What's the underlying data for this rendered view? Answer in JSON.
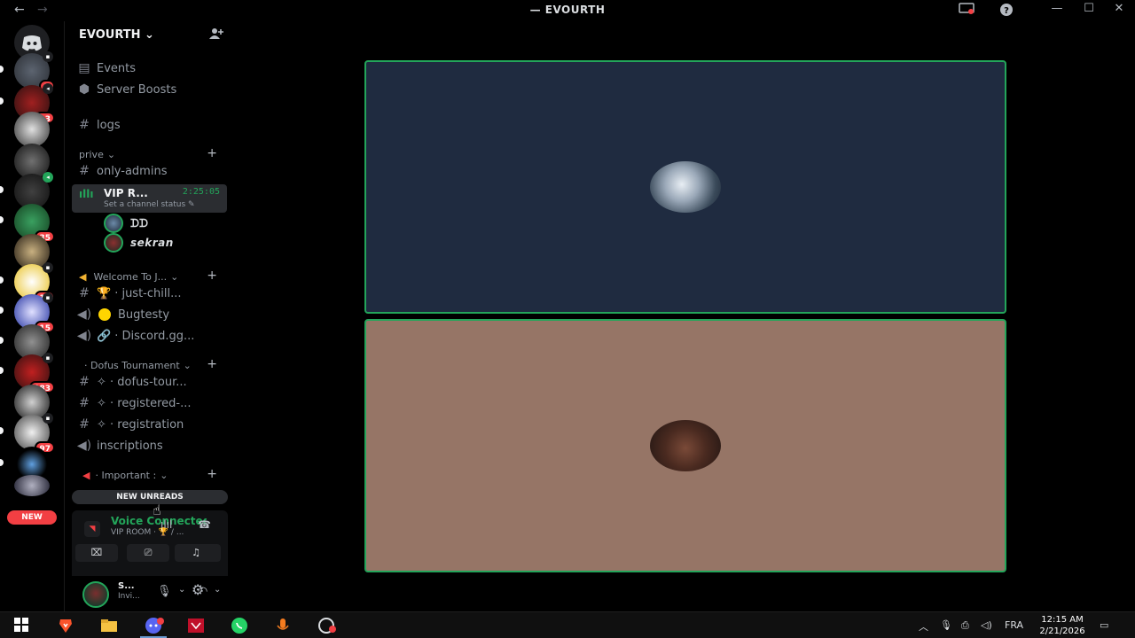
{
  "window": {
    "title": "EVOURTH",
    "back_icon": "arrow-left",
    "forward_icon": "arrow-right"
  },
  "rail": {
    "new_label": "NEW",
    "badges": [
      "5",
      "13",
      "35",
      "11",
      "15",
      "183",
      "97"
    ]
  },
  "server": {
    "name": "EVOURTH"
  },
  "channels": {
    "events": "Events",
    "server_boosts": "Server Boosts",
    "logs": "logs",
    "cat_prive": "prive",
    "only_admins": "only-admins",
    "vip_name": "VIP R...",
    "vip_time": "2:25:05",
    "vip_status": "Set a channel status",
    "voice_users": [
      "ᗪᗪ",
      "sekran"
    ],
    "cat_welcome": "Welcome To J...",
    "just_chill": "· just-chill...",
    "bugtesty": "Bugtesty",
    "discord_gg": "· Discord.gg...",
    "cat_dofus": "· Dofus Tournament",
    "dofus_tour": "✧ · dofus-tour...",
    "registered": "✧ · registered-...",
    "registration": "✧ · registration",
    "inscriptions": "inscriptions",
    "cat_important": "· Important :",
    "new_unreads": "NEW UNREADS"
  },
  "voice_panel": {
    "status": "Voice Connected",
    "room": "VIP ROOM · 🏆 / ..."
  },
  "user_panel": {
    "name": "S...",
    "status": "Invi..."
  },
  "taskbar": {
    "language": "FRA",
    "time": "12:15 AM",
    "date": "2/21/2026"
  },
  "colors": {
    "tile_top": "#1f2b40",
    "tile_bottom": "#967566",
    "accent_green": "#23a55a",
    "unread_red": "#f23f43"
  }
}
